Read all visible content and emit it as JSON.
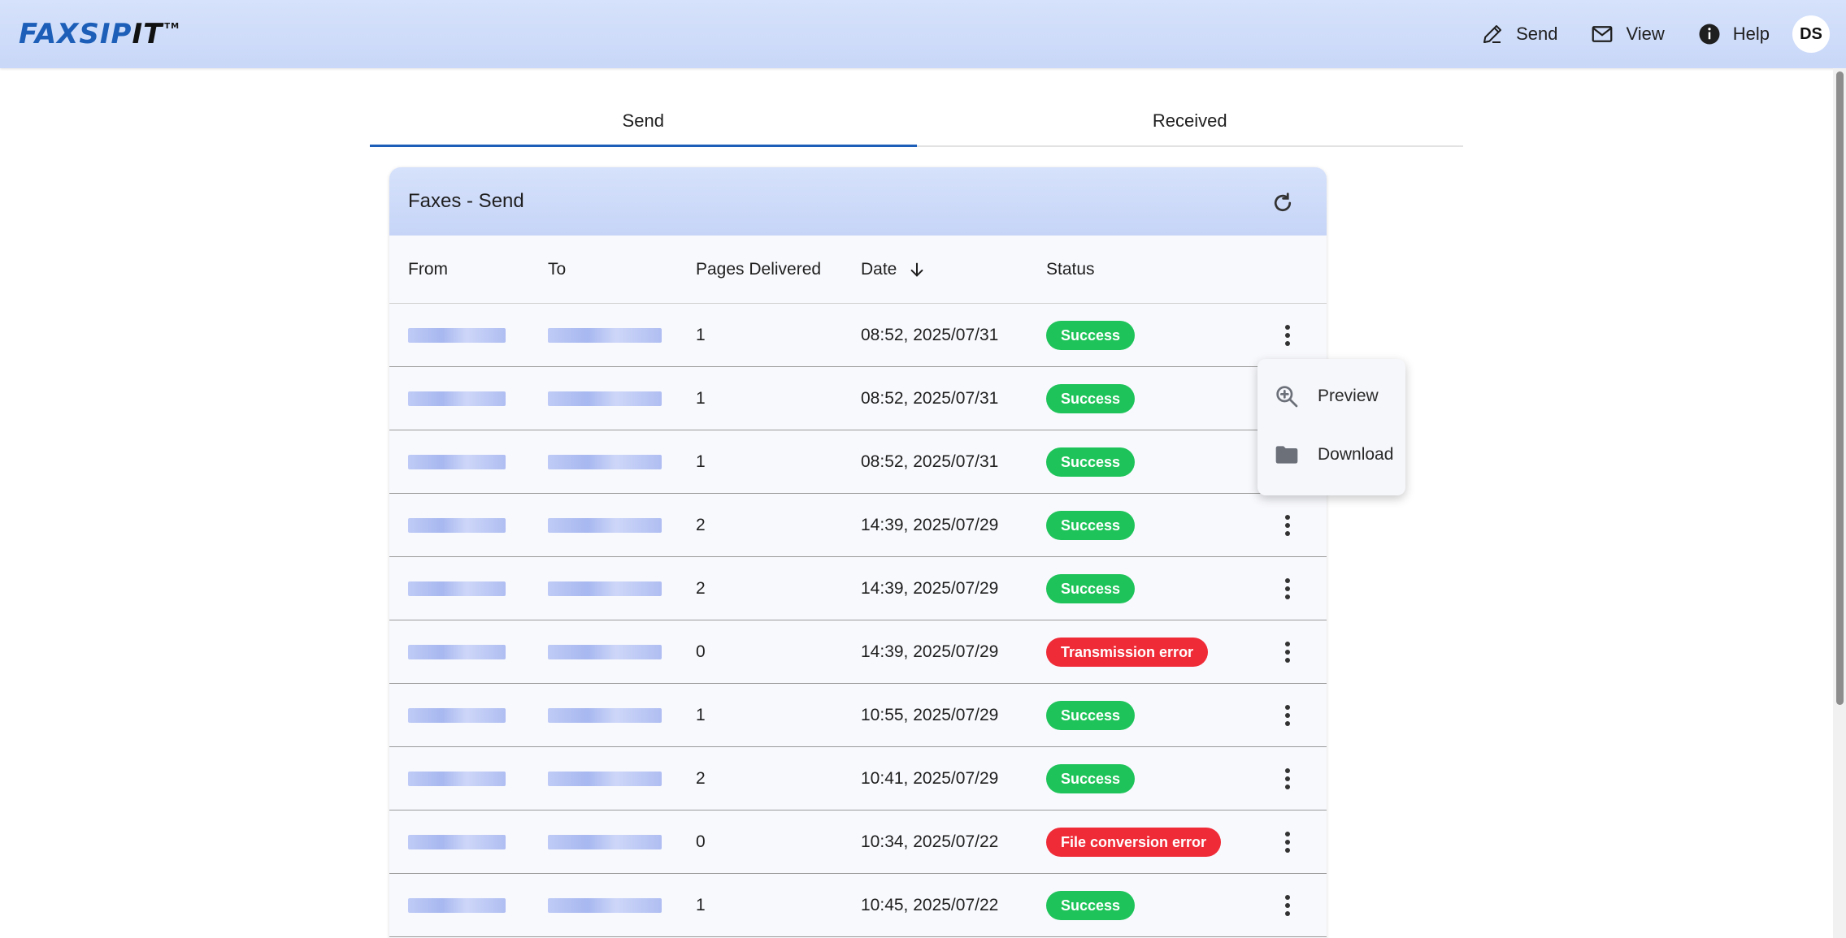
{
  "header": {
    "logo_part1": "FAXSIP",
    "logo_part2": "IT",
    "logo_tm": "TM",
    "nav": [
      {
        "label": "Send",
        "icon": "pen-icon"
      },
      {
        "label": "View",
        "icon": "mail-icon"
      },
      {
        "label": "Help",
        "icon": "info-icon"
      }
    ],
    "avatar_initials": "DS"
  },
  "tabs": [
    {
      "label": "Send",
      "active": true
    },
    {
      "label": "Received",
      "active": false
    }
  ],
  "card": {
    "title": "Faxes - Send",
    "columns": {
      "from": "From",
      "to": "To",
      "pages": "Pages Delivered",
      "date": "Date",
      "status": "Status"
    },
    "rows": [
      {
        "pages": "1",
        "date": "08:52, 2025/07/31",
        "status": "Success"
      },
      {
        "pages": "1",
        "date": "08:52, 2025/07/31",
        "status": "Success"
      },
      {
        "pages": "1",
        "date": "08:52, 2025/07/31",
        "status": "Success"
      },
      {
        "pages": "2",
        "date": "14:39, 2025/07/29",
        "status": "Success"
      },
      {
        "pages": "2",
        "date": "14:39, 2025/07/29",
        "status": "Success"
      },
      {
        "pages": "0",
        "date": "14:39, 2025/07/29",
        "status": "Transmission error"
      },
      {
        "pages": "1",
        "date": "10:55, 2025/07/29",
        "status": "Success"
      },
      {
        "pages": "2",
        "date": "10:41, 2025/07/29",
        "status": "Success"
      },
      {
        "pages": "0",
        "date": "10:34, 2025/07/22",
        "status": "File conversion error"
      },
      {
        "pages": "1",
        "date": "10:45, 2025/07/22",
        "status": "Success"
      }
    ]
  },
  "menu": {
    "items": [
      {
        "label": "Preview",
        "icon": "zoom-in-icon"
      },
      {
        "label": "Download",
        "icon": "folder-icon"
      }
    ]
  },
  "colors": {
    "accent": "#1d5fb8",
    "success": "#1ec459",
    "error": "#ef2b37",
    "header_bg": "#d6e2fb"
  }
}
